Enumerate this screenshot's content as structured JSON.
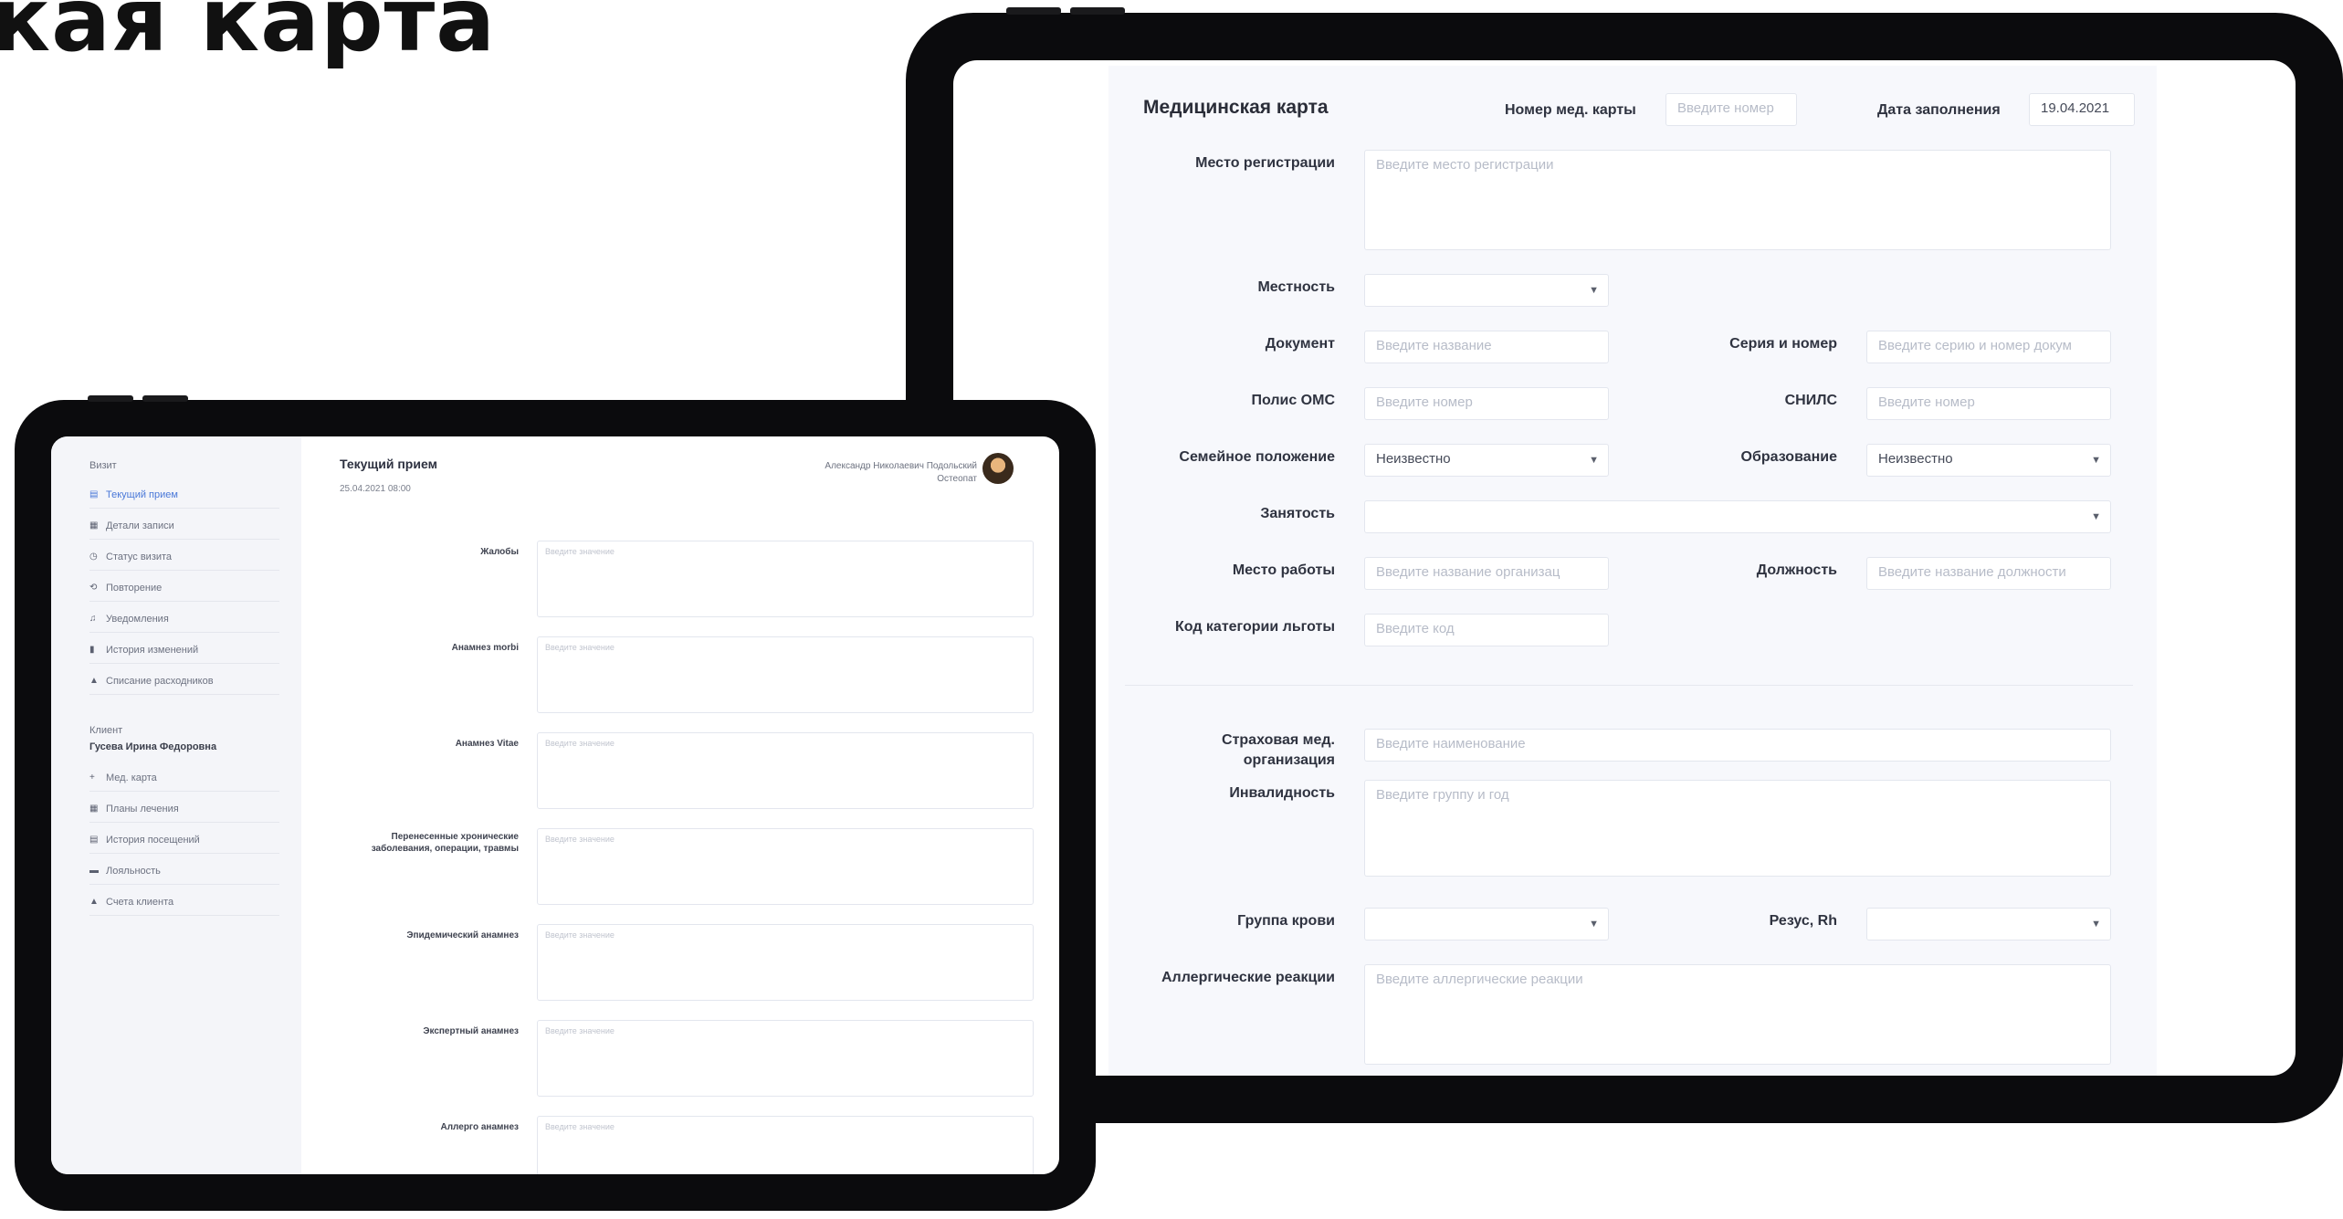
{
  "headline": "кая карта",
  "med_card": {
    "title": "Медицинская карта",
    "card_number_label": "Номер мед. карты",
    "card_number_placeholder": "Введите номер",
    "fill_date_label": "Дата заполнения",
    "fill_date_value": "19.04.2021",
    "registration_label": "Место регистрации",
    "registration_placeholder": "Введите место регистрации",
    "locality_label": "Местность",
    "document_label": "Документ",
    "document_placeholder": "Введите название",
    "series_label": "Серия и номер",
    "series_placeholder": "Введите серию и номер докум",
    "oms_label": "Полис ОМС",
    "oms_placeholder": "Введите номер",
    "snils_label": "СНИЛС",
    "snils_placeholder": "Введите номер",
    "marital_label": "Семейное положение",
    "marital_value": "Неизвестно",
    "education_label": "Образование",
    "education_value": "Неизвестно",
    "employment_label": "Занятость",
    "workplace_label": "Место работы",
    "workplace_placeholder": "Введите название организац",
    "position_label": "Должность",
    "position_placeholder": "Введите название должности",
    "benefit_label": "Код категории льготы",
    "benefit_placeholder": "Введите код",
    "insurer_label_1": "Страховая мед.",
    "insurer_label_2": "организация",
    "insurer_placeholder": "Введите наименование",
    "disability_label": "Инвалидность",
    "disability_placeholder": "Введите группу и год",
    "blood_label": "Группа крови",
    "rh_label": "Резус, Rh",
    "allergy_label": "Аллергические реакции",
    "allergy_placeholder": "Введите аллергические реакции"
  },
  "visit": {
    "sidebar": {
      "visit_heading": "Визит",
      "items": [
        {
          "label": "Текущий прием",
          "icon": "list-icon"
        },
        {
          "label": "Детали записи",
          "icon": "grid-icon"
        },
        {
          "label": "Статус визита",
          "icon": "clock-icon"
        },
        {
          "label": "Повторение",
          "icon": "repeat-icon"
        },
        {
          "label": "Уведомления",
          "icon": "bell-icon"
        },
        {
          "label": "История изменений",
          "icon": "file-icon"
        },
        {
          "label": "Списание расходников",
          "icon": "box-icon"
        }
      ],
      "client_heading": "Клиент",
      "client_name": "Гусева Ирина Федоровна",
      "client_items": [
        {
          "label": "Мед. карта",
          "icon": "plus-icon"
        },
        {
          "label": "Планы лечения",
          "icon": "grid-icon"
        },
        {
          "label": "История посещений",
          "icon": "history-icon"
        },
        {
          "label": "Лояльность",
          "icon": "card-icon"
        },
        {
          "label": "Счета клиента",
          "icon": "bag-icon"
        }
      ]
    },
    "title": "Текущий прием",
    "date": "25.04.2021 08:00",
    "doctor_name": "Александр Николаевич Подольский",
    "doctor_role": "Остеопат",
    "fields": [
      {
        "label": "Жалобы",
        "placeholder": "Введите значение"
      },
      {
        "label": "Анамнез morbi",
        "placeholder": "Введите значение"
      },
      {
        "label": "Анамнез Vitae",
        "placeholder": "Введите значение"
      },
      {
        "label": "Перенесенные хронические заболевания, операции, травмы",
        "placeholder": "Введите значение"
      },
      {
        "label": "Эпидемический анамнез",
        "placeholder": "Введите значение"
      },
      {
        "label": "Экспертный анамнез",
        "placeholder": "Введите значение"
      },
      {
        "label": "Аллерго анамнез",
        "placeholder": "Введите значение"
      }
    ]
  }
}
